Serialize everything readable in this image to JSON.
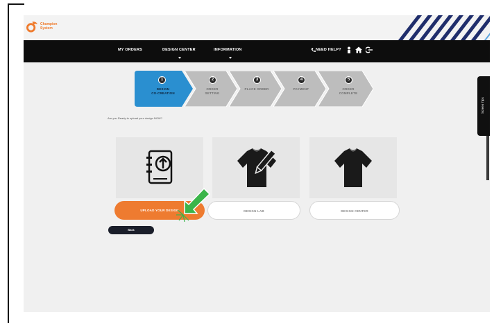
{
  "brand": {
    "name_line1": "Champion",
    "name_line2": "System",
    "accent": "#ee7b30",
    "logo_icon": "champion-logo-icon"
  },
  "nav": {
    "items": [
      "MY ORDERS",
      "DESIGN CENTER",
      "INFORMATION"
    ],
    "help": "NEED HELP?",
    "icons": [
      "phone-icon",
      "user-icon",
      "home-icon",
      "logout-icon"
    ]
  },
  "steps": [
    {
      "num": "1",
      "label_line1": "DESIGN",
      "label_line2": "CO-CREATION",
      "active": true
    },
    {
      "num": "2",
      "label_line1": "ORDER",
      "label_line2": "SETTING",
      "active": false
    },
    {
      "num": "3",
      "label_line1": "PLACE ORDER",
      "label_line2": "",
      "active": false
    },
    {
      "num": "4",
      "label_line1": "PAYMENT",
      "label_line2": "",
      "active": false
    },
    {
      "num": "5",
      "label_line1": "ORDER",
      "label_line2": "COMPLETE",
      "active": false
    }
  ],
  "question": "Are you Ready to upload your design NOW?",
  "options": [
    {
      "label": "UPLOAD YOUR DESIGN",
      "icon": "upload-document-icon",
      "primary": true
    },
    {
      "label": "DESIGN LAB",
      "icon": "jersey-edit-icon",
      "primary": false
    },
    {
      "label": "DESIGN CENTER",
      "icon": "jersey-icon",
      "primary": false
    }
  ],
  "back": "Back",
  "tips": "Screen Tips",
  "colors": {
    "active_step": "#2a8fd0",
    "inactive_step": "#bdbdbd",
    "navbar": "#0d0d0d",
    "pointer": "#3bb54a"
  }
}
